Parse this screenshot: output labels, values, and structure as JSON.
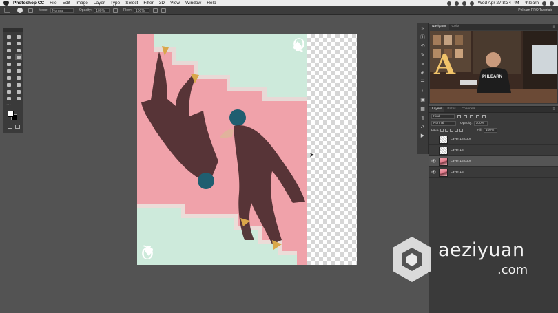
{
  "menubar": {
    "app_name": "Photoshop CC",
    "items": [
      "File",
      "Edit",
      "Image",
      "Layer",
      "Type",
      "Select",
      "Filter",
      "3D",
      "View",
      "Window",
      "Help"
    ],
    "clock": "Wed Apr 27  8:34 PM",
    "user": "Phlearn"
  },
  "options_bar": {
    "mode_label": "Mode:",
    "mode_value": "Normal",
    "opacity_label": "Opacity:",
    "opacity_value": "100%",
    "flow_label": "Flow:",
    "flow_value": "100%",
    "document_title": "Phlearn PRO Tutorials"
  },
  "panels": {
    "navigator_tabs": [
      "Navigator",
      "Color"
    ],
    "layers_tabs": [
      "Layers",
      "Paths",
      "Channels"
    ]
  },
  "layers_panel": {
    "filter_kind": "Kind",
    "blend_mode": "Normal",
    "opacity_label": "Opacity:",
    "opacity_value": "100%",
    "lock_label": "Lock:",
    "fill_label": "Fill:",
    "fill_value": "100%",
    "layers": [
      {
        "name": "Layer 18 copy",
        "visible": false,
        "selected": false,
        "thumb": "blank"
      },
      {
        "name": "Layer 18",
        "visible": false,
        "selected": false,
        "thumb": "blank"
      },
      {
        "name": "Layer 16 copy",
        "visible": true,
        "selected": true,
        "thumb": "art"
      },
      {
        "name": "Layer 16",
        "visible": true,
        "selected": false,
        "thumb": "art"
      }
    ]
  },
  "canvas_card": {
    "corner_letter": "Q",
    "corner_suit_icon": "spade-icon"
  },
  "navigator_preview": {
    "sign_letter": "A",
    "shirt_text": "PHLEARN"
  },
  "watermark": {
    "name": "aeziyuan",
    "tld": ".com"
  },
  "colors": {
    "workspace": "#535353",
    "panel": "#3a3a3a",
    "card_pink": "#f0a2aa",
    "card_mint": "#cdeadb",
    "selection": "#555555"
  }
}
